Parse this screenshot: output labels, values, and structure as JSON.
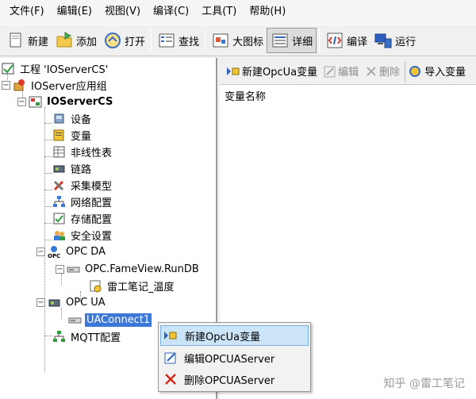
{
  "menubar": {
    "items": [
      "文件(F)",
      "编辑(E)",
      "视图(V)",
      "编译(C)",
      "工具(T)",
      "帮助(H)"
    ]
  },
  "toolbar": {
    "new_label": "新建",
    "add_label": "添加",
    "open_label": "打开",
    "find_label": "查找",
    "large_icon_label": "大图标",
    "detail_label": "详细",
    "compile_label": "编译",
    "run_label": "运行"
  },
  "tree": {
    "project": "工程 'IOServerCS'",
    "group": "IOServer应用组",
    "server": "IOServerCS",
    "items": [
      "设备",
      "变量",
      "非线性表",
      "链路",
      "采集模型",
      "网络配置",
      "存储配置",
      "安全设置"
    ],
    "opc_da": "OPC DA",
    "opc_da_child": "OPC.FameView.RunDB",
    "opc_da_var": "雷工笔记_温度",
    "opc_ua": "OPC UA",
    "ua_connect": "UAConnect1",
    "mqtt": "MQTT配置"
  },
  "right_panel": {
    "new_var_label": "新建OpcUa变量",
    "edit_label": "编辑",
    "delete_label": "删除",
    "import_label": "导入变量",
    "column_header": "变量名称"
  },
  "context_menu": {
    "items": [
      "新建OpcUa变量",
      "编辑OPCUAServer",
      "删除OPCUAServer"
    ]
  },
  "watermark": "知乎 @雷工笔记"
}
